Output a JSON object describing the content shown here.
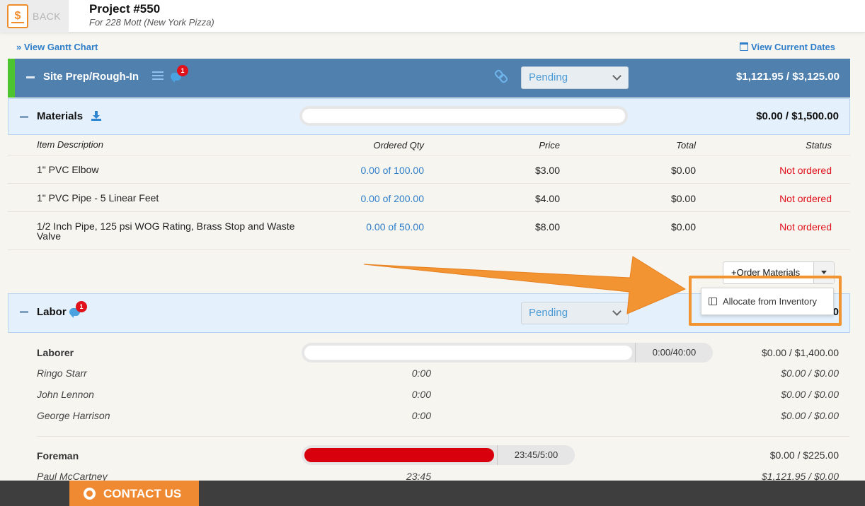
{
  "header": {
    "back_label": "BACK",
    "back_icon": "$",
    "project_title": "Project #550",
    "project_subtitle": "For 228 Mott (New York Pizza)"
  },
  "links": {
    "gantt": "» View Gantt Chart",
    "dates": "View Current Dates"
  },
  "phase": {
    "title": "Site Prep/Rough-In",
    "comment_badge": "1",
    "status": "Pending",
    "amount": "$1,121.95 / $3,125.00",
    "accent_color": "#4bc42d",
    "bg_color": "#5080ad"
  },
  "materials": {
    "title": "Materials",
    "amount": "$0.00 / $1,500.00",
    "columns": {
      "desc": "Item Description",
      "qty": "Ordered Qty",
      "price": "Price",
      "total": "Total",
      "status": "Status"
    },
    "rows": [
      {
        "desc": "1\" PVC Elbow",
        "qty": "0.00 of 100.00",
        "price": "$3.00",
        "total": "$0.00",
        "status": "Not ordered"
      },
      {
        "desc": "1\" PVC Pipe - 5 Linear Feet",
        "qty": "0.00 of 200.00",
        "price": "$4.00",
        "total": "$0.00",
        "status": "Not ordered"
      },
      {
        "desc": "1/2 Inch Pipe, 125 psi WOG Rating, Brass Stop and Waste Valve",
        "qty": "0.00 of 50.00",
        "price": "$8.00",
        "total": "$0.00",
        "status": "Not ordered"
      }
    ],
    "order_button": "+Order Materials",
    "dropdown_item": "Allocate from Inventory"
  },
  "labor": {
    "title": "Labor",
    "comment_badge": "1",
    "status": "Pending",
    "amount_partial": "0",
    "groups": [
      {
        "role": "Laborer",
        "hours": "0:00/40:00",
        "progress": 0,
        "amount": "$0.00 / $1,400.00",
        "people": [
          {
            "name": "Ringo Starr",
            "time": "0:00",
            "amount": "$0.00 / $0.00"
          },
          {
            "name": "John Lennon",
            "time": "0:00",
            "amount": "$0.00 / $0.00"
          },
          {
            "name": "George Harrison",
            "time": "0:00",
            "amount": "$0.00 / $0.00"
          }
        ]
      },
      {
        "role": "Foreman",
        "hours": "23:45/5:00",
        "progress": 1.0,
        "progress_color": "#d8000c",
        "amount": "$0.00 / $225.00",
        "people": [
          {
            "name": "Paul McCartney",
            "time": "23:45",
            "amount": "$1,121.95 / $0.00"
          }
        ]
      }
    ]
  },
  "footer": {
    "contact_label": "CONTACT US"
  },
  "colors": {
    "annotation": "#f29431",
    "link": "#2f7ec9",
    "status_red": "#e0111b"
  }
}
